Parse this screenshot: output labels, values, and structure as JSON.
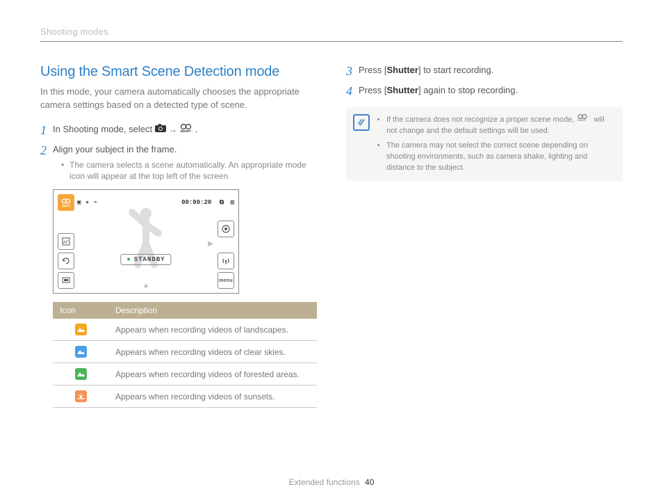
{
  "header": {
    "breadcrumb": "Shooting modes"
  },
  "section": {
    "title": "Using the Smart Scene Detection mode",
    "intro": "In this mode, your camera automatically chooses the appropriate camera settings based on a detected type of scene."
  },
  "steps": {
    "s1": {
      "num": "1",
      "text_a": "In Shooting mode, select ",
      "text_b": "."
    },
    "s2": {
      "num": "2",
      "text": "Align your subject in the frame.",
      "sub": "The camera selects a scene automatically. An appropriate mode icon will appear at the top left of the screen."
    },
    "s3": {
      "num": "3",
      "text_a": "Press [",
      "bold": "Shutter",
      "text_b": "] to start recording."
    },
    "s4": {
      "num": "4",
      "text_a": "Press [",
      "bold": "Shutter",
      "text_b": "] again to stop recording."
    }
  },
  "lcd": {
    "top_icons": "▣ ✷ ⌁",
    "time": "00:00:20",
    "standby": "STANDBY",
    "menu": "menu"
  },
  "iconTable": {
    "head_icon": "Icon",
    "head_desc": "Description",
    "rows": [
      {
        "desc": "Appears when recording videos of landscapes."
      },
      {
        "desc": "Appears when recording videos of clear skies."
      },
      {
        "desc": "Appears when recording videos of forested areas."
      },
      {
        "desc": "Appears when recording videos of sunsets."
      }
    ]
  },
  "note": {
    "b1a": "If the camera does not recognize a proper scene mode, ",
    "b1b": " will not change and the default settings will be used.",
    "b2": "The camera may not select the correct scene depending on shooting environments, such as camera shake, lighting and distance to the subject."
  },
  "footer": {
    "label": "Extended functions",
    "page": "40"
  }
}
